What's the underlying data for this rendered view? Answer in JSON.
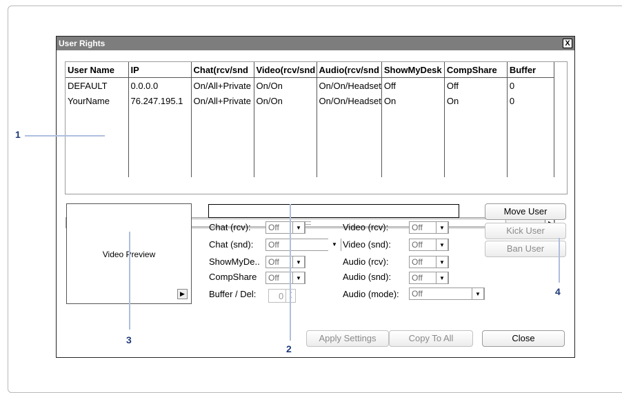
{
  "window": {
    "title": "User Rights",
    "close_label": "X"
  },
  "grid": {
    "columns": [
      "User Name",
      "IP",
      "Chat(rcv/snd",
      "Video(rcv/snd",
      "Audio(rcv/snd",
      "ShowMyDesk",
      "CompShare",
      "Buffer"
    ],
    "rows": [
      [
        "DEFAULT",
        "0.0.0.0",
        "On/All+Private",
        "On/On",
        "On/On/Headset",
        "Off",
        "Off",
        "0"
      ],
      [
        "YourName",
        "76.247.195.1",
        "On/All+Private",
        "On/On",
        "On/On/Headset",
        "On",
        "On",
        "0"
      ]
    ],
    "scroll_left": "◂",
    "scroll_right": "▸"
  },
  "video_preview": {
    "label": "Video Preview",
    "play_icon": "▶"
  },
  "settings": {
    "name_value": "",
    "chat_rcv": {
      "label": "Chat (rcv):",
      "value": "Off"
    },
    "chat_snd": {
      "label": "Chat (snd):",
      "value": "Off"
    },
    "showmydesk": {
      "label": "ShowMyDe..",
      "value": "Off"
    },
    "compshare": {
      "label": "CompShare",
      "value": "Off"
    },
    "buffer": {
      "label": "Buffer / Del:",
      "value": "0"
    },
    "video_rcv": {
      "label": "Video (rcv):",
      "value": "Off"
    },
    "video_snd": {
      "label": "Video (snd):",
      "value": "Off"
    },
    "audio_rcv": {
      "label": "Audio (rcv):",
      "value": "Off"
    },
    "audio_snd": {
      "label": "Audio (snd):",
      "value": "Off"
    },
    "audio_mode": {
      "label": "Audio (mode):",
      "value": "Off"
    }
  },
  "buttons": {
    "move_user": "Move User",
    "kick_user": "Kick User",
    "ban_user": "Ban User",
    "apply_settings": "Apply Settings",
    "copy_to_all": "Copy To All",
    "close": "Close"
  },
  "callouts": {
    "c1": "1",
    "c2": "2",
    "c3": "3",
    "c4": "4"
  }
}
